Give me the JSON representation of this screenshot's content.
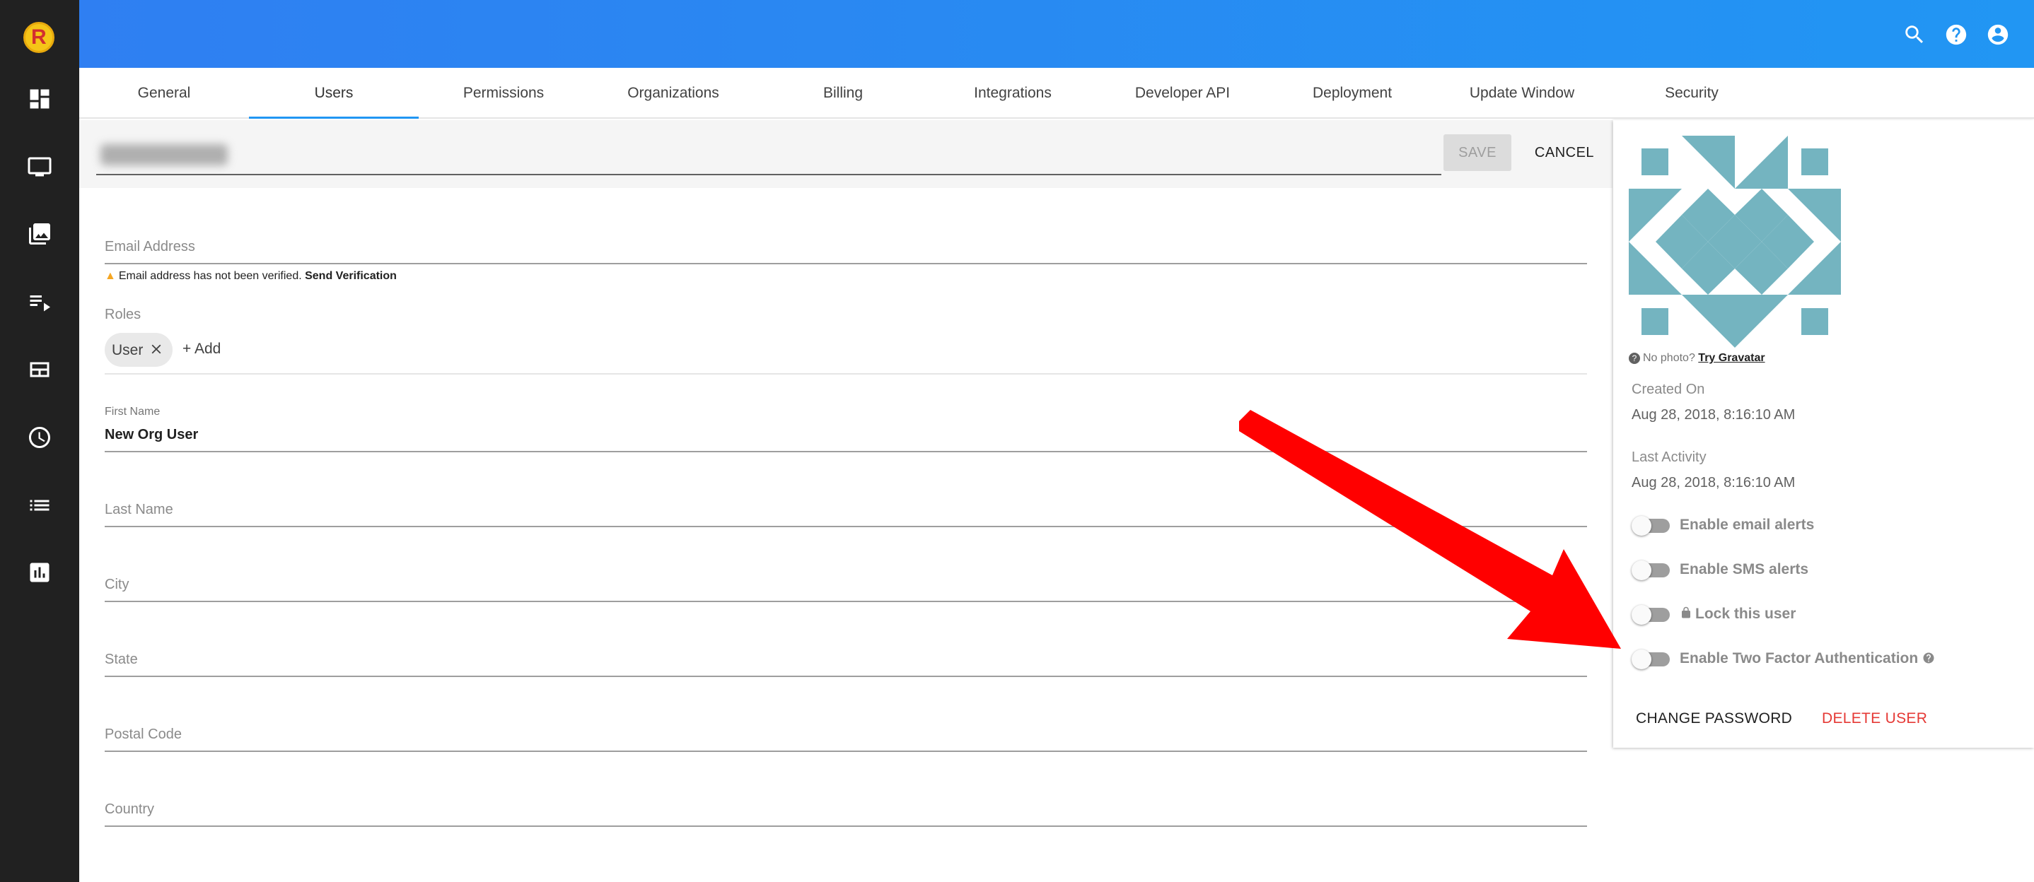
{
  "header": {
    "search_icon": "search-icon",
    "help_icon": "help-icon",
    "account_icon": "account-icon"
  },
  "sidebar": {
    "logo_letter": "R",
    "items": [
      "dashboard-icon",
      "monitor-icon",
      "gallery-icon",
      "playlist-icon",
      "layout-icon",
      "clock-icon",
      "list-icon",
      "chart-icon"
    ]
  },
  "tabs": [
    {
      "label": "General"
    },
    {
      "label": "Users"
    },
    {
      "label": "Permissions"
    },
    {
      "label": "Organizations"
    },
    {
      "label": "Billing"
    },
    {
      "label": "Integrations"
    },
    {
      "label": "Developer API"
    },
    {
      "label": "Deployment"
    },
    {
      "label": "Update Window"
    },
    {
      "label": "Security"
    }
  ],
  "active_tab": "Users",
  "form": {
    "save_label": "SAVE",
    "cancel_label": "CANCEL",
    "email": {
      "label": "Email Address",
      "value": ""
    },
    "verify_message": "Email address has not been verified.",
    "verify_link": "Send Verification",
    "roles_label": "Roles",
    "roles": [
      "User"
    ],
    "add_role": "+ Add",
    "first_name": {
      "label": "First Name",
      "value": "New Org User"
    },
    "last_name": {
      "label": "Last Name"
    },
    "city": {
      "label": "City"
    },
    "state": {
      "label": "State"
    },
    "postal_code": {
      "label": "Postal Code"
    },
    "country": {
      "label": "Country"
    }
  },
  "profile": {
    "no_photo": "No photo?",
    "try_gravatar": "Try Gravatar",
    "created_on_label": "Created On",
    "created_on": "Aug 28, 2018, 8:16:10 AM",
    "last_activity_label": "Last Activity",
    "last_activity": "Aug 28, 2018, 8:16:10 AM",
    "toggles": [
      {
        "label": "Enable email alerts",
        "on": false
      },
      {
        "label": "Enable SMS alerts",
        "on": false
      },
      {
        "label": "Lock this user",
        "on": false
      },
      {
        "label": "Enable Two Factor Authentication",
        "on": false
      }
    ],
    "change_password": "CHANGE PASSWORD",
    "delete_user": "DELETE USER"
  },
  "colors": {
    "header_blue": "#2196f3",
    "sidebar": "#212121",
    "delete_red": "#e53935",
    "arrow_red": "#ff0000",
    "gravatar_teal": "#74b4c0"
  }
}
